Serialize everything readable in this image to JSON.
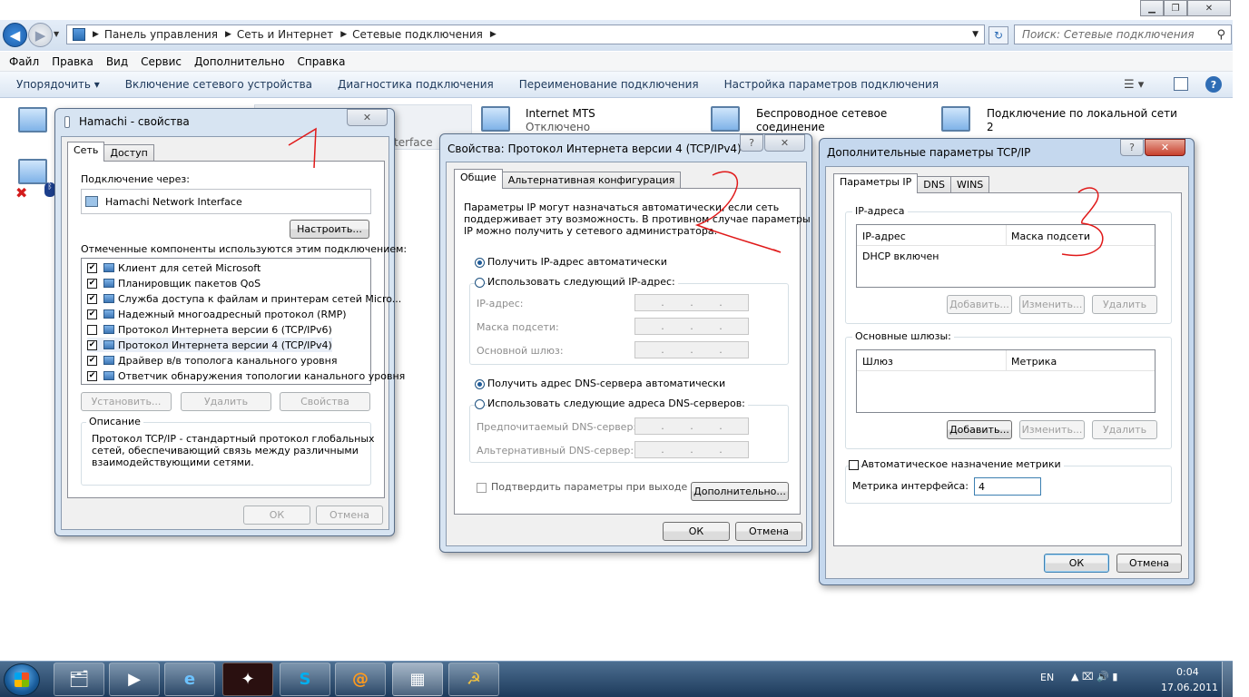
{
  "explorer": {
    "address_segments": [
      "Панель управления",
      "Сеть и Интернет",
      "Сетевые подключения"
    ],
    "search_placeholder": "Поиск: Сетевые подключения",
    "menu": [
      "Файл",
      "Правка",
      "Вид",
      "Сервис",
      "Дополнительно",
      "Справка"
    ],
    "commands": {
      "organize": "Упорядочить",
      "enable": "Включение сетевого устройства",
      "diagnose": "Диагностика подключения",
      "rename": "Переименование подключения",
      "settings": "Настройка параметров подключения"
    },
    "connections": [
      {
        "name": "Internet MTS",
        "status": "Отключено"
      },
      {
        "name": "Беспроводное сетевое",
        "status": "соединение"
      },
      {
        "name": "Подключение по локальной сети",
        "status": "2"
      }
    ],
    "partial_text": "terface"
  },
  "hamachi": {
    "title": "Hamachi - свойства",
    "tabs": [
      "Сеть",
      "Доступ"
    ],
    "connect_via_label": "Подключение через:",
    "adapter": "Hamachi Network Interface",
    "configure_button": "Настроить...",
    "components_label": "Отмеченные компоненты используются этим подключением:",
    "components": [
      {
        "label": "Клиент для сетей Microsoft",
        "checked": true
      },
      {
        "label": "Планировщик пакетов QoS",
        "checked": true
      },
      {
        "label": "Служба доступа к файлам и принтерам сетей Micro...",
        "checked": true
      },
      {
        "label": "Надежный многоадресный протокол (RMP)",
        "checked": true
      },
      {
        "label": "Протокол Интернета версии 6 (TCP/IPv6)",
        "checked": false
      },
      {
        "label": "Протокол Интернета версии 4 (TCP/IPv4)",
        "checked": true
      },
      {
        "label": "Драйвер в/в тополога канального уровня",
        "checked": true
      },
      {
        "label": "Ответчик обнаружения топологии канального уровня",
        "checked": true
      }
    ],
    "install_button": "Установить...",
    "remove_button": "Удалить",
    "properties_button": "Свойства",
    "description_title": "Описание",
    "description_line1": "Протокол TCP/IP - стандартный протокол глобальных",
    "description_line2": "сетей, обеспечивающий связь между различными",
    "description_line3": "взаимодействующими сетями.",
    "ok": "ОК",
    "cancel": "Отмена"
  },
  "ipv4": {
    "title": "Свойства: Протокол Интернета версии 4 (TCP/IPv4)",
    "help": "?",
    "tabs": [
      "Общие",
      "Альтернативная конфигурация"
    ],
    "intro_line1": "Параметры IP могут назначаться автоматически, если сеть",
    "intro_line2": "поддерживает эту возможность. В противном случае параметры",
    "intro_line3": "IP можно получить у сетевого администратора.",
    "auto_ip": "Получить IP-адрес автоматически",
    "manual_ip": "Использовать следующий IP-адрес:",
    "ip_label": "IP-адрес:",
    "mask_label": "Маска подсети:",
    "gateway_label": "Основной шлюз:",
    "auto_dns": "Получить адрес DNS-сервера автоматически",
    "manual_dns": "Использовать следующие адреса DNS-серверов:",
    "preferred_dns": "Предпочитаемый DNS-сервер:",
    "alternate_dns": "Альтернативный DNS-сервер:",
    "validate": "Подтвердить параметры при выходе",
    "advanced_button": "Дополнительно...",
    "ok": "ОК",
    "cancel": "Отмена"
  },
  "advanced": {
    "title": "Дополнительные параметры TCP/IP",
    "help": "?",
    "tabs": [
      "Параметры IP",
      "DNS",
      "WINS"
    ],
    "ip_group": "IP-адреса",
    "col_ip": "IP-адрес",
    "col_mask": "Маска подсети",
    "ip_row": "DHCP включен",
    "add": "Добавить...",
    "edit": "Изменить...",
    "remove": "Удалить",
    "gw_group": "Основные шлюзы:",
    "col_gw": "Шлюз",
    "col_metric": "Метрика",
    "auto_metric": "Автоматическое назначение метрики",
    "metric_label": "Метрика интерфейса:",
    "metric_value": "4",
    "ok": "ОК",
    "cancel": "Отмена"
  },
  "taskbar": {
    "lang": "EN",
    "time": "0:04",
    "date": "17.06.2011"
  },
  "annotations": [
    "1",
    "2",
    "2",
    "3"
  ]
}
